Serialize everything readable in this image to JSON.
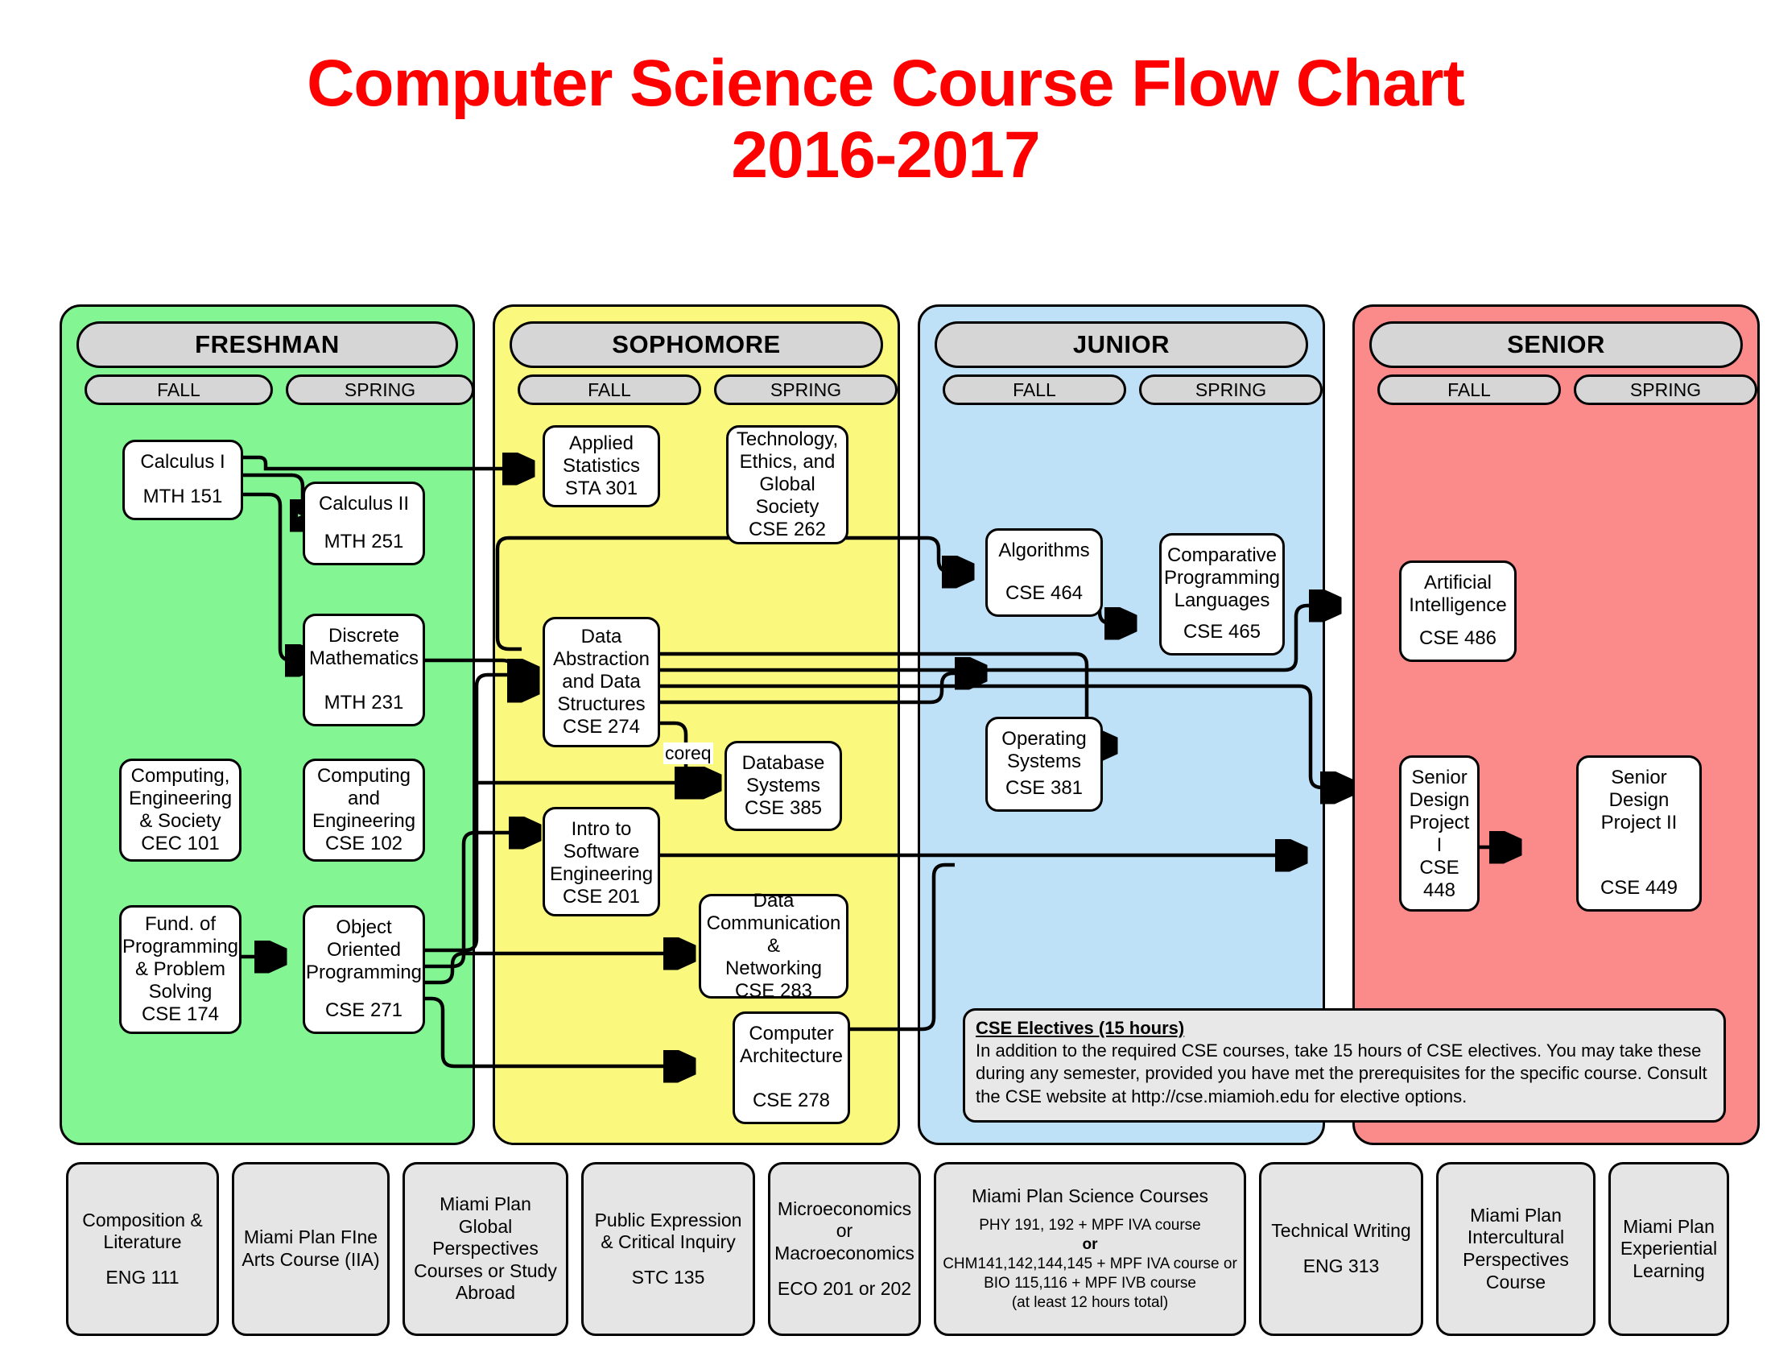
{
  "title": {
    "line1": "Computer Science Course Flow Chart",
    "line2": "2016-2017",
    "color": "#ff0000"
  },
  "years": [
    {
      "id": "freshman",
      "label": "FRESHMAN",
      "color": "#83f593",
      "fall": "FALL",
      "spring": "SPRING"
    },
    {
      "id": "sophomore",
      "label": "SOPHOMORE",
      "color": "#fbf87e",
      "fall": "FALL",
      "spring": "SPRING"
    },
    {
      "id": "junior",
      "label": "JUNIOR",
      "color": "#bfe1f8",
      "fall": "FALL",
      "spring": "SPRING"
    },
    {
      "id": "senior",
      "label": "SENIOR",
      "color": "#fb8a8a",
      "fall": "FALL",
      "spring": "SPRING"
    }
  ],
  "courses": [
    {
      "key": "mth151",
      "name": "Calculus I",
      "code": "MTH 151"
    },
    {
      "key": "mth251",
      "name": "Calculus II",
      "code": "MTH 251"
    },
    {
      "key": "mth231",
      "name": "Discrete\nMathematics",
      "code": "MTH 231"
    },
    {
      "key": "cec101",
      "name": "Computing,\nEngineering\n& Society",
      "code": "CEC 101"
    },
    {
      "key": "cse102",
      "name": "Computing\nand\nEngineering",
      "code": "CSE 102"
    },
    {
      "key": "cse174",
      "name": "Fund. of\nProgramming\n& Problem\nSolving",
      "code": "CSE 174"
    },
    {
      "key": "cse271",
      "name": "Object\nOriented\nProgramming",
      "code": "CSE 271"
    },
    {
      "key": "sta301",
      "name": "Applied\nStatistics",
      "code": "STA 301"
    },
    {
      "key": "cse262",
      "name": "Technology,\nEthics, and\nGlobal\nSociety",
      "code": "CSE 262"
    },
    {
      "key": "cse274",
      "name": "Data\nAbstraction\nand Data\nStructures",
      "code": "CSE 274"
    },
    {
      "key": "cse385",
      "name": "Database\nSystems",
      "code": "CSE 385"
    },
    {
      "key": "cse201",
      "name": "Intro to\nSoftware\nEngineering",
      "code": "CSE 201"
    },
    {
      "key": "cse283",
      "name": "Data\nCommunication &\nNetworking",
      "code": "CSE 283"
    },
    {
      "key": "cse278",
      "name": "Computer\nArchitecture",
      "code": "CSE 278"
    },
    {
      "key": "cse464",
      "name": "Algorithms",
      "code": "CSE 464"
    },
    {
      "key": "cse465",
      "name": "Comparative\nProgramming\nLanguages",
      "code": "CSE 465"
    },
    {
      "key": "cse381",
      "name": "Operating\nSystems",
      "code": "CSE 381"
    },
    {
      "key": "cse486",
      "name": "Artificial\nIntelligence",
      "code": "CSE 486"
    },
    {
      "key": "cse448",
      "name": "Senior\nDesign\nProject I",
      "code": "CSE 448"
    },
    {
      "key": "cse449",
      "name": "Senior\nDesign\nProject II",
      "code": "CSE 449"
    }
  ],
  "coreq_label": "coreq",
  "electives": {
    "heading": "CSE Electives (15 hours)",
    "body": "In addition to the required CSE courses, take 15 hours of CSE electives.  You may take these during any semester, provided you have met the prerequisites for the specific course.  Consult the CSE website at http://cse.miamioh.edu for elective options."
  },
  "miami_plan": [
    {
      "key": "mp1",
      "name": "Composition &\nLiterature",
      "code": "ENG 111"
    },
    {
      "key": "mp2",
      "name": "Miami Plan FIne\nArts Course (IIA)",
      "code": ""
    },
    {
      "key": "mp3",
      "name": "Miami Plan\nGlobal\nPerspectives\nCourses or Study\nAbroad",
      "code": ""
    },
    {
      "key": "mp4",
      "name": "Public Expression &\nCritical Inquiry",
      "code": "STC 135"
    },
    {
      "key": "mp5",
      "name": "Microeconomics\nor\nMacroeconomics",
      "code": "ECO 201 or 202"
    },
    {
      "key": "mp6",
      "name": "Miami Plan Science Courses",
      "detail_lines": [
        "PHY 191, 192 + MPF IVA course",
        "or",
        "CHM141,142,144,145 + MPF IVA course   or",
        "BIO 115,116 + MPF IVB course",
        "(at least 12 hours total)"
      ]
    },
    {
      "key": "mp7",
      "name": "Technical Writing",
      "code": "ENG 313"
    },
    {
      "key": "mp8",
      "name": "Miami Plan\nIntercultural\nPerspectives\nCourse",
      "code": ""
    },
    {
      "key": "mp9",
      "name": "Miami Plan\nExperiential\nLearning",
      "code": ""
    }
  ]
}
